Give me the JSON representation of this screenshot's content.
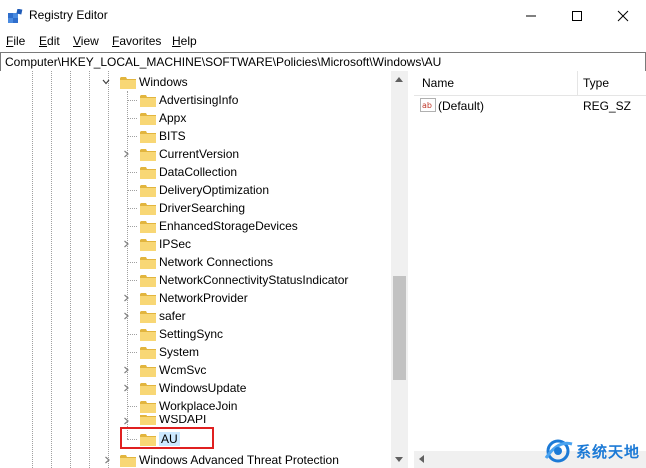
{
  "window": {
    "title": "Registry Editor"
  },
  "menu": [
    {
      "label": "File",
      "accel": "F",
      "rest": "ile"
    },
    {
      "label": "Edit",
      "accel": "E",
      "rest": "dit"
    },
    {
      "label": "View",
      "accel": "V",
      "rest": "iew"
    },
    {
      "label": "Favorites",
      "accel": "F",
      "rest": "avorites"
    },
    {
      "label": "Help",
      "accel": "H",
      "rest": "elp"
    }
  ],
  "address": {
    "path": "Computer\\HKEY_LOCAL_MACHINE\\SOFTWARE\\Policies\\Microsoft\\Windows\\AU"
  },
  "tree": {
    "parent": {
      "label": "Windows",
      "expanded": true
    },
    "children": [
      {
        "label": "AdvertisingInfo",
        "expandable": false
      },
      {
        "label": "Appx",
        "expandable": false
      },
      {
        "label": "BITS",
        "expandable": false
      },
      {
        "label": "CurrentVersion",
        "expandable": true
      },
      {
        "label": "DataCollection",
        "expandable": false
      },
      {
        "label": "DeliveryOptimization",
        "expandable": false
      },
      {
        "label": "DriverSearching",
        "expandable": false
      },
      {
        "label": "EnhancedStorageDevices",
        "expandable": false
      },
      {
        "label": "IPSec",
        "expandable": true
      },
      {
        "label": "Network Connections",
        "expandable": false
      },
      {
        "label": "NetworkConnectivityStatusIndicator",
        "expandable": false
      },
      {
        "label": "NetworkProvider",
        "expandable": true
      },
      {
        "label": "safer",
        "expandable": true
      },
      {
        "label": "SettingSync",
        "expandable": false
      },
      {
        "label": "System",
        "expandable": false
      },
      {
        "label": "WcmSvc",
        "expandable": true
      },
      {
        "label": "WindowsUpdate",
        "expandable": true
      },
      {
        "label": "WorkplaceJoin",
        "expandable": false
      },
      {
        "label": "WSDAPI",
        "expandable": true
      },
      {
        "label": "AU",
        "expandable": false,
        "selected": true
      }
    ],
    "next_sibling": {
      "label": "Windows Advanced Threat Protection",
      "expandable": true
    }
  },
  "list": {
    "columns": {
      "name": "Name",
      "type": "Type"
    },
    "rows": [
      {
        "name": "(Default)",
        "type": "REG_SZ",
        "icon": "string-value-icon"
      }
    ]
  },
  "watermark": {
    "text": "系统天地"
  },
  "colors": {
    "folder": "#f8d775",
    "folder_dark": "#e2b53e",
    "selection": "#cce8ff",
    "highlight_box": "#e02020",
    "watermark": "#1c7ad6"
  }
}
